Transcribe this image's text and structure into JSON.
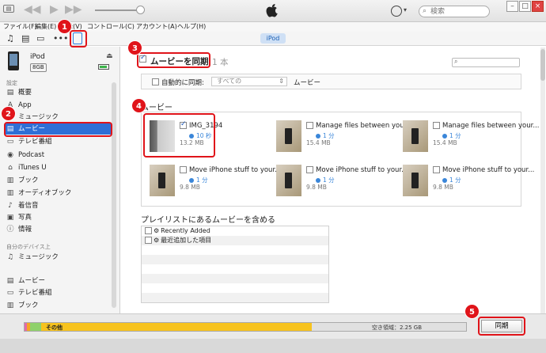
{
  "titlebar": {
    "menu_icon": "window-menu-icon",
    "transport": [
      "previous-icon",
      "play-icon",
      "next-icon"
    ],
    "volume_level": 0.9,
    "search_placeholder": "検索",
    "window_buttons": [
      "minimize-icon",
      "maximize-icon",
      "close-icon"
    ]
  },
  "menubar": [
    "ファイル(F)",
    "編集(E)",
    "表示(V)",
    "コントロール(C)",
    "アカウント(A)",
    "ヘルプ(H)"
  ],
  "toolbar": {
    "icons": [
      "music-icon",
      "movie-icon",
      "tv-icon",
      "more-icon",
      "device-icon"
    ],
    "device_pill": "iPod"
  },
  "sidebar": {
    "device_name": "iPod",
    "capacity": "8GB",
    "settings_heading": "設定",
    "settings_items": [
      {
        "label": "概要",
        "icon": "summary-icon"
      },
      {
        "label": "App",
        "icon": "app-icon"
      },
      {
        "label": "ミュージック",
        "icon": "music-icon"
      },
      {
        "label": "ムービー",
        "icon": "movie-icon"
      },
      {
        "label": "テレビ番組",
        "icon": "tv-icon"
      },
      {
        "label": "Podcast",
        "icon": "podcast-icon"
      },
      {
        "label": "iTunes U",
        "icon": "itunes-u-icon"
      },
      {
        "label": "ブック",
        "icon": "book-icon"
      },
      {
        "label": "オーディオブック",
        "icon": "audiobook-icon"
      },
      {
        "label": "着信音",
        "icon": "ringtone-icon"
      },
      {
        "label": "写真",
        "icon": "photo-icon"
      },
      {
        "label": "情報",
        "icon": "info-icon"
      }
    ],
    "on_device_heading": "自分のデバイス上",
    "on_device_items": [
      {
        "label": "ミュージック",
        "icon": "music-icon"
      },
      {
        "label": "ムービー",
        "icon": "movie-icon"
      },
      {
        "label": "テレビ番組",
        "icon": "tv-icon"
      },
      {
        "label": "ブック",
        "icon": "book-icon"
      }
    ]
  },
  "main": {
    "sync_title": "ムービーを同期",
    "sync_count": "1 本",
    "auto_label": "自動的に同期:",
    "auto_select": "すべての",
    "auto_suffix": "ムービー",
    "movies_heading": "ムービー",
    "movies": [
      {
        "title": "IMG_3194",
        "duration": "10 秒",
        "size": "13.2 MB",
        "checked": true
      },
      {
        "title": "Manage files between your...",
        "duration": "1 分",
        "size": "15.4 MB",
        "checked": false
      },
      {
        "title": "Manage files between your...",
        "duration": "1 分",
        "size": "15.4 MB",
        "checked": false
      },
      {
        "title": "Move iPhone stuff to your...",
        "duration": "1 分",
        "size": "9.8 MB",
        "checked": false
      },
      {
        "title": "Move iPhone stuff to your...",
        "duration": "1 分",
        "size": "9.8 MB",
        "checked": false
      },
      {
        "title": "Move iPhone stuff to your...",
        "duration": "1 分",
        "size": "9.8 MB",
        "checked": false
      }
    ],
    "playlist_heading": "プレイリストにあるムービーを含める",
    "playlists": [
      "Recently Added",
      "最近追加した項目"
    ]
  },
  "footer": {
    "other_label": "その他",
    "free_label": "空き領域：2.25 GB",
    "sync_button": "同期",
    "segments": [
      {
        "color": "#e26aa8",
        "fraction": 0.006
      },
      {
        "color": "#f5a623",
        "fraction": 0.006
      },
      {
        "color": "#8fd16b",
        "fraction": 0.026
      },
      {
        "color": "#f7c31e",
        "fraction": 0.612
      },
      {
        "color": "#e0e0e0",
        "fraction": 0.35
      }
    ]
  },
  "annotations": [
    "1",
    "2",
    "3",
    "4",
    "5"
  ],
  "colors": {
    "highlight": "#e0141a",
    "selection": "#2f6fd6"
  }
}
